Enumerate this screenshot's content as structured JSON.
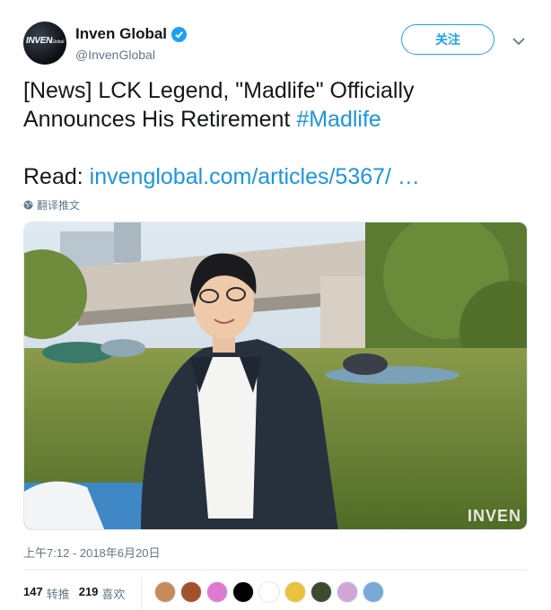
{
  "account": {
    "display_name": "Inven Global",
    "handle": "@InvenGlobal",
    "avatar_text": "INVEN",
    "avatar_subtext": "Global",
    "verified_icon": "verified-badge-icon"
  },
  "actions": {
    "follow_label": "关注",
    "more_icon": "chevron-down-icon"
  },
  "tweet": {
    "line1_prefix": "[News] LCK Legend, \"Madlife\" Officially",
    "line2_prefix": "Announces His Retirement ",
    "hashtag": "#Madlife",
    "read_label": "Read: ",
    "link_text": "invenglobal.com/articles/5367/  …",
    "translate_label": "翻译推文",
    "translate_icon": "globe-icon"
  },
  "media": {
    "watermark": "INVEN"
  },
  "meta": {
    "timestamp": "上午7:12 - 2018年6月20日"
  },
  "stats": {
    "retweets_count": "147",
    "retweets_label": "转推",
    "likes_count": "219",
    "likes_label": "喜欢"
  },
  "likers": [
    {
      "name": "liker-avatar-1",
      "color": "#c98a5a"
    },
    {
      "name": "liker-avatar-2",
      "color": "#a0522d"
    },
    {
      "name": "liker-avatar-3",
      "color": "#e07ad0"
    },
    {
      "name": "liker-avatar-4",
      "color": "#000000"
    },
    {
      "name": "liker-avatar-5",
      "color": "#ffffff"
    },
    {
      "name": "liker-avatar-6",
      "color": "#e8c23a"
    },
    {
      "name": "liker-avatar-7",
      "color": "#3d4a2e"
    },
    {
      "name": "liker-avatar-8",
      "color": "#cfa7d8"
    },
    {
      "name": "liker-avatar-9",
      "color": "#7aa9d6"
    }
  ],
  "colors": {
    "accent": "#1da1f2",
    "link": "#1b95e0",
    "secondary_text": "#657786"
  }
}
